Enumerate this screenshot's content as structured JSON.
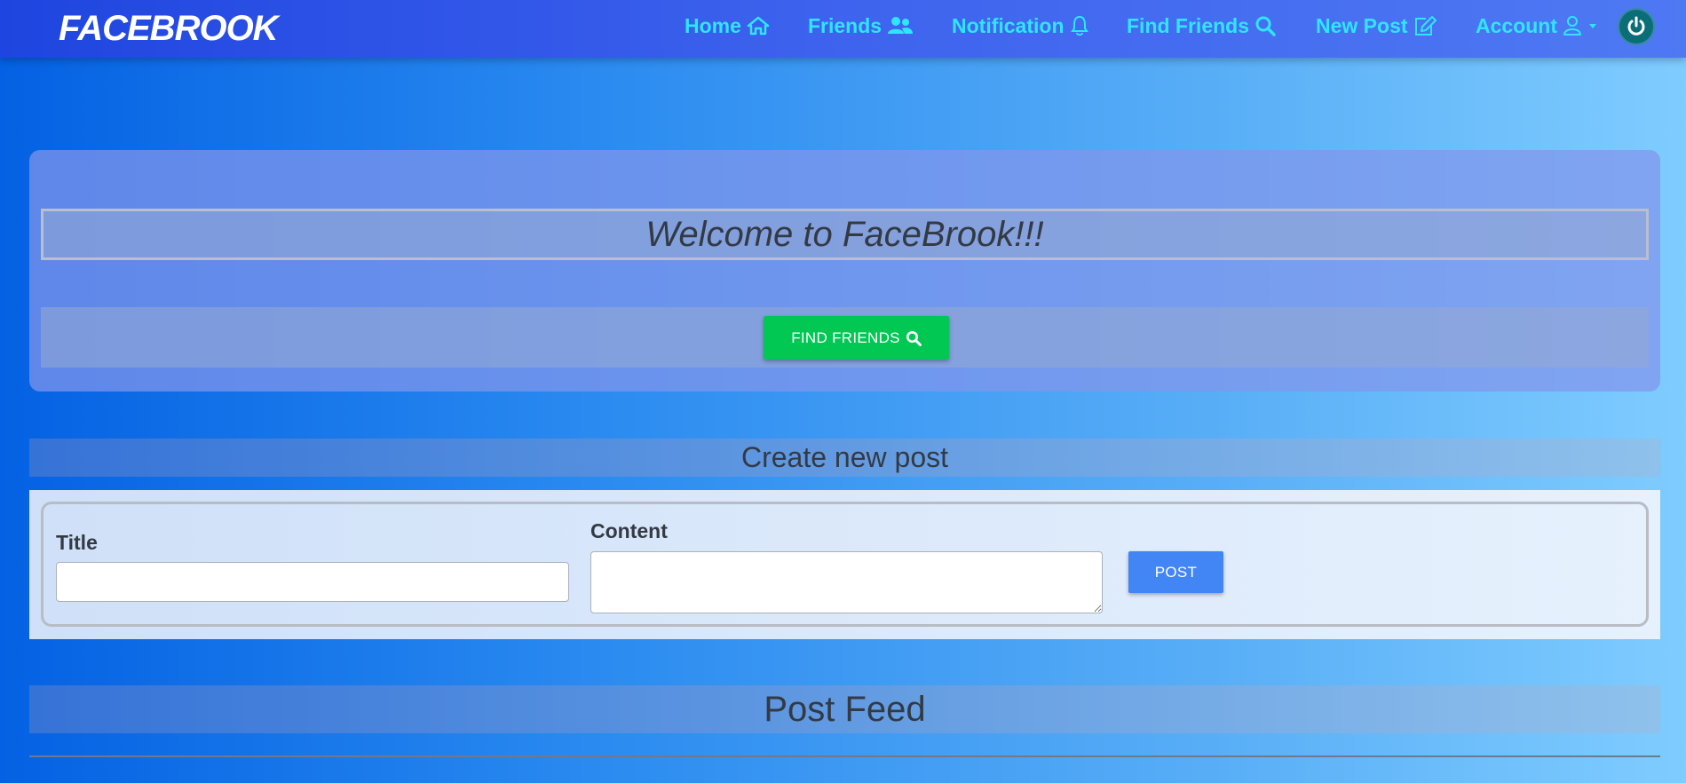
{
  "navbar": {
    "brand": "FACEBROOK",
    "items": [
      {
        "label": "Home",
        "icon": "home-icon"
      },
      {
        "label": "Friends",
        "icon": "users-icon"
      },
      {
        "label": "Notification",
        "icon": "bell-icon"
      },
      {
        "label": "Find Friends",
        "icon": "search-icon"
      },
      {
        "label": "New Post",
        "icon": "edit-icon"
      },
      {
        "label": "Account",
        "icon": "user-icon"
      }
    ],
    "power_icon": "power-icon",
    "text_color": "#2ee6ff"
  },
  "welcome": {
    "heading": "Welcome to FaceBrook!!!",
    "find_friends_button": "FIND FRIENDS",
    "button_color": "#00c853"
  },
  "create_post": {
    "header": "Create new post",
    "title_label": "Title",
    "title_value": "",
    "content_label": "Content",
    "content_value": "",
    "post_button": "POST",
    "button_color": "#4285f4"
  },
  "feed": {
    "header": "Post Feed"
  }
}
